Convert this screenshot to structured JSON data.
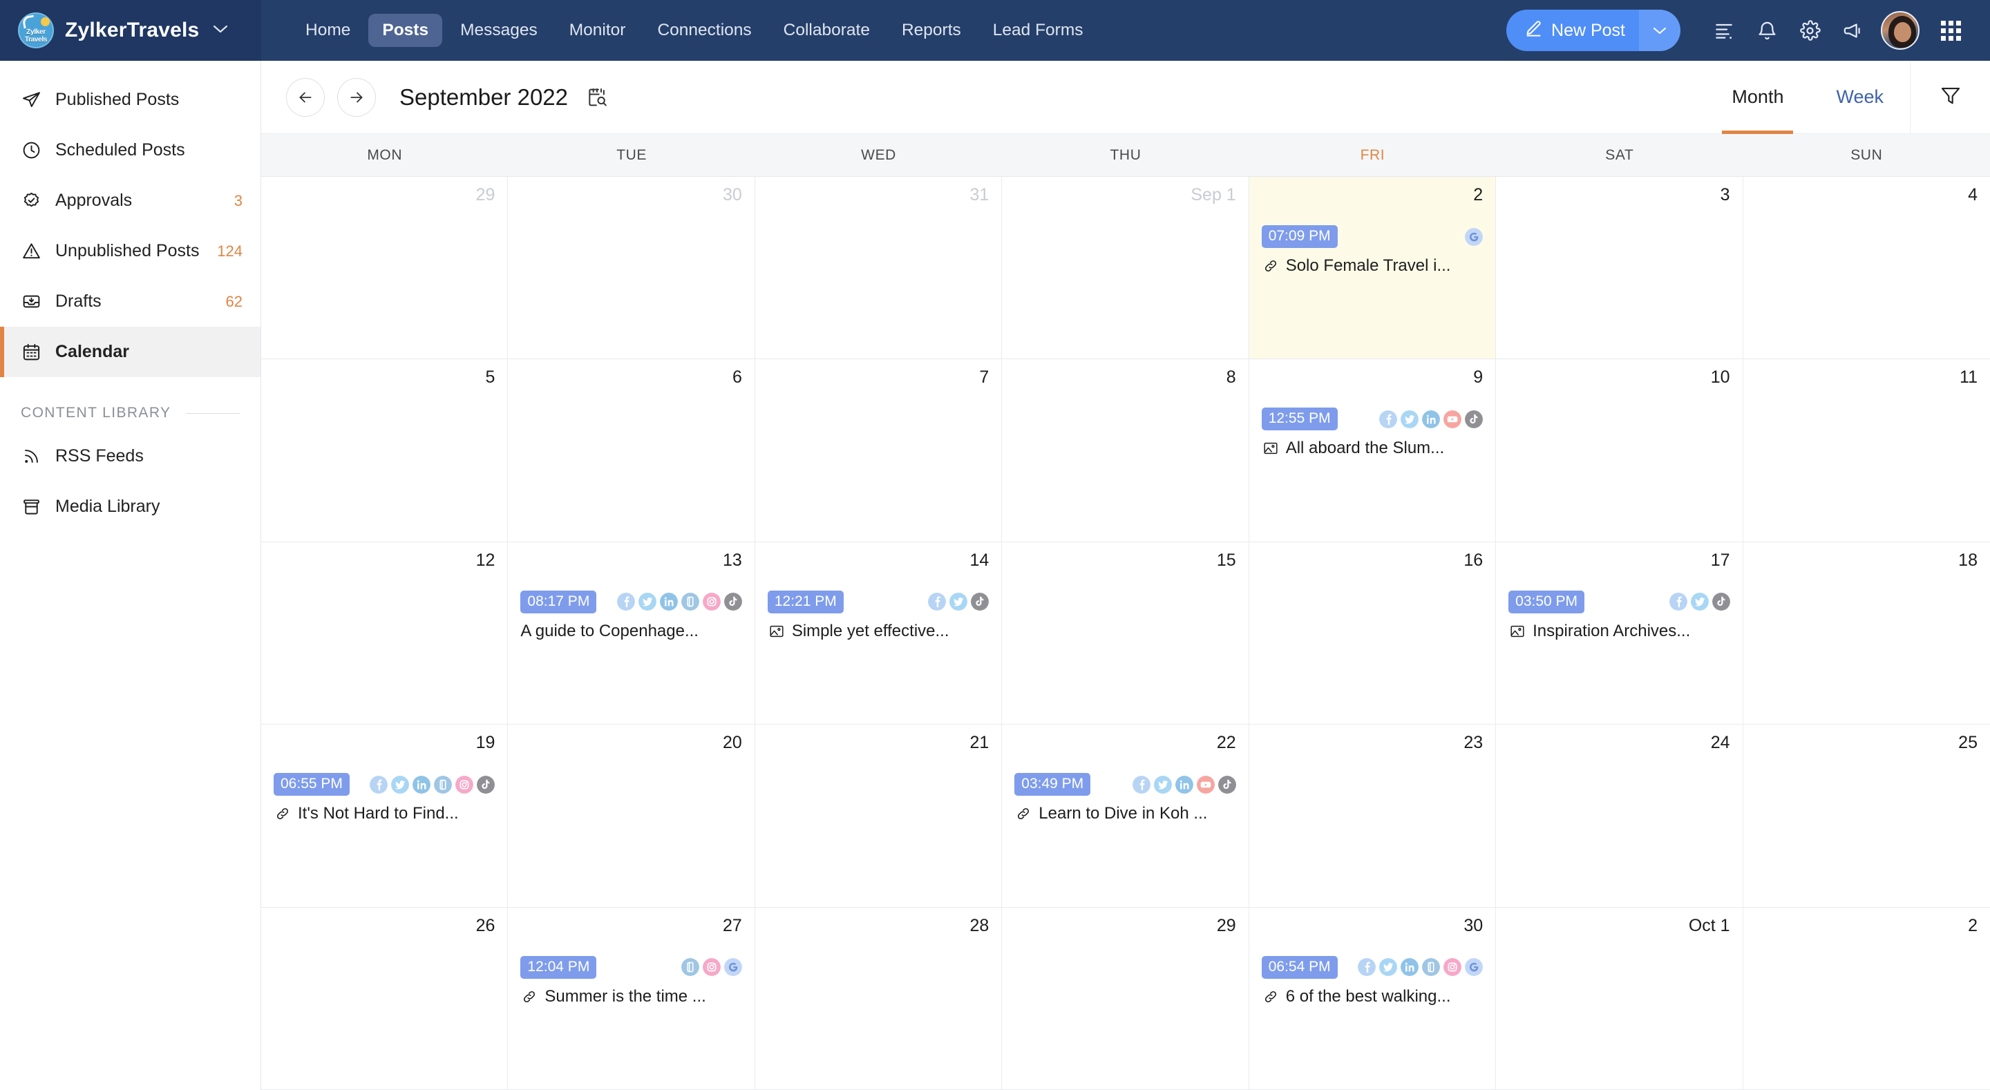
{
  "brand": {
    "name": "ZylkerTravels",
    "logo_line1": "Zylker",
    "logo_line2": "Travels",
    "caret": "⌄"
  },
  "topnav": {
    "items": [
      {
        "label": "Home",
        "active": false
      },
      {
        "label": "Posts",
        "active": true
      },
      {
        "label": "Messages",
        "active": false
      },
      {
        "label": "Monitor",
        "active": false
      },
      {
        "label": "Connections",
        "active": false
      },
      {
        "label": "Collaborate",
        "active": false
      },
      {
        "label": "Reports",
        "active": false
      },
      {
        "label": "Lead Forms",
        "active": false
      }
    ],
    "new_post_label": "New Post",
    "new_post_caret": "⌄",
    "icons": [
      "list-icon",
      "bell-icon",
      "gear-icon",
      "megaphone-icon",
      "avatar",
      "apps-grid-icon"
    ]
  },
  "sidebar": {
    "items": [
      {
        "label": "Published Posts",
        "count": "",
        "icon": "send-icon",
        "active": false
      },
      {
        "label": "Scheduled Posts",
        "count": "",
        "icon": "clock-icon",
        "active": false
      },
      {
        "label": "Approvals",
        "count": "3",
        "icon": "check-badge-icon",
        "active": false
      },
      {
        "label": "Unpublished Posts",
        "count": "124",
        "icon": "warning-icon",
        "active": false
      },
      {
        "label": "Drafts",
        "count": "62",
        "icon": "inbox-icon",
        "active": false
      },
      {
        "label": "Calendar",
        "count": "",
        "icon": "calendar-icon",
        "active": true
      }
    ],
    "library_heading": "CONTENT LIBRARY",
    "library_items": [
      {
        "label": "RSS Feeds",
        "icon": "rss-icon"
      },
      {
        "label": "Media Library",
        "icon": "media-library-icon"
      }
    ]
  },
  "calendar": {
    "title": "September 2022",
    "prev_label": "←",
    "next_label": "→",
    "views": [
      {
        "label": "Month",
        "active": true
      },
      {
        "label": "Week",
        "active": false
      }
    ],
    "weekdays": [
      {
        "label": "MON",
        "today": false
      },
      {
        "label": "TUE",
        "today": false
      },
      {
        "label": "WED",
        "today": false
      },
      {
        "label": "THU",
        "today": false
      },
      {
        "label": "FRI",
        "today": true
      },
      {
        "label": "SAT",
        "today": false
      },
      {
        "label": "SUN",
        "today": false
      }
    ],
    "accent_color": "#e08545",
    "today_cell_color": "#fdfbe7",
    "time_badge_color": "#7e9ceb",
    "weeks": [
      [
        {
          "day": "29",
          "muted": true,
          "today": false,
          "events": []
        },
        {
          "day": "30",
          "muted": true,
          "today": false,
          "events": []
        },
        {
          "day": "31",
          "muted": true,
          "today": false,
          "events": []
        },
        {
          "day": "Sep 1",
          "muted": true,
          "today": false,
          "events": []
        },
        {
          "day": "2",
          "muted": false,
          "today": true,
          "events": [
            {
              "time": "07:09 PM",
              "title": "Solo Female Travel i...",
              "type_icon": "link-icon",
              "socials": [
                "google"
              ]
            }
          ]
        },
        {
          "day": "3",
          "muted": false,
          "today": false,
          "events": []
        },
        {
          "day": "4",
          "muted": false,
          "today": false,
          "events": []
        }
      ],
      [
        {
          "day": "5",
          "muted": false,
          "today": false,
          "events": []
        },
        {
          "day": "6",
          "muted": false,
          "today": false,
          "events": []
        },
        {
          "day": "7",
          "muted": false,
          "today": false,
          "events": []
        },
        {
          "day": "8",
          "muted": false,
          "today": false,
          "events": []
        },
        {
          "day": "9",
          "muted": false,
          "today": false,
          "events": [
            {
              "time": "12:55 PM",
              "title": "All aboard the Slum...",
              "type_icon": "image-icon",
              "socials": [
                "facebook",
                "twitter",
                "linkedin",
                "youtube",
                "tiktok"
              ]
            }
          ]
        },
        {
          "day": "10",
          "muted": false,
          "today": false,
          "events": []
        },
        {
          "day": "11",
          "muted": false,
          "today": false,
          "events": []
        }
      ],
      [
        {
          "day": "12",
          "muted": false,
          "today": false,
          "events": []
        },
        {
          "day": "13",
          "muted": false,
          "today": false,
          "events": [
            {
              "time": "08:17 PM",
              "title": "A guide to Copenhage...",
              "type_icon": "none",
              "socials": [
                "facebook",
                "twitter",
                "linkedin",
                "mastodon",
                "instagram",
                "tiktok"
              ]
            }
          ]
        },
        {
          "day": "14",
          "muted": false,
          "today": false,
          "events": [
            {
              "time": "12:21 PM",
              "title": "Simple yet effective...",
              "type_icon": "image-icon",
              "socials": [
                "facebook",
                "twitter",
                "tiktok"
              ]
            }
          ]
        },
        {
          "day": "15",
          "muted": false,
          "today": false,
          "events": []
        },
        {
          "day": "16",
          "muted": false,
          "today": false,
          "events": []
        },
        {
          "day": "17",
          "muted": false,
          "today": false,
          "events": [
            {
              "time": "03:50 PM",
              "title": "Inspiration Archives...",
              "type_icon": "image-icon",
              "socials": [
                "facebook",
                "twitter",
                "tiktok"
              ]
            }
          ]
        },
        {
          "day": "18",
          "muted": false,
          "today": false,
          "events": []
        }
      ],
      [
        {
          "day": "19",
          "muted": false,
          "today": false,
          "events": [
            {
              "time": "06:55 PM",
              "title": "It's Not Hard to Find...",
              "type_icon": "link-icon",
              "socials": [
                "facebook",
                "twitter",
                "linkedin",
                "mastodon",
                "instagram",
                "tiktok"
              ]
            }
          ]
        },
        {
          "day": "20",
          "muted": false,
          "today": false,
          "events": []
        },
        {
          "day": "21",
          "muted": false,
          "today": false,
          "events": []
        },
        {
          "day": "22",
          "muted": false,
          "today": false,
          "events": [
            {
              "time": "03:49 PM",
              "title": "Learn to Dive in Koh ...",
              "type_icon": "link-icon",
              "socials": [
                "facebook",
                "twitter",
                "linkedin",
                "youtube",
                "tiktok"
              ]
            }
          ]
        },
        {
          "day": "23",
          "muted": false,
          "today": false,
          "events": []
        },
        {
          "day": "24",
          "muted": false,
          "today": false,
          "events": []
        },
        {
          "day": "25",
          "muted": false,
          "today": false,
          "events": []
        }
      ],
      [
        {
          "day": "26",
          "muted": false,
          "today": false,
          "events": []
        },
        {
          "day": "27",
          "muted": false,
          "today": false,
          "events": [
            {
              "time": "12:04 PM",
              "title": "Summer is the time ...",
              "type_icon": "link-icon",
              "socials": [
                "mastodon",
                "instagram",
                "google"
              ]
            }
          ]
        },
        {
          "day": "28",
          "muted": false,
          "today": false,
          "events": []
        },
        {
          "day": "29",
          "muted": false,
          "today": false,
          "events": []
        },
        {
          "day": "30",
          "muted": false,
          "today": false,
          "events": [
            {
              "time": "06:54 PM",
              "title": "6 of the best walking...",
              "type_icon": "link-icon",
              "socials": [
                "facebook",
                "twitter",
                "linkedin",
                "mastodon",
                "instagram",
                "google"
              ]
            }
          ]
        },
        {
          "day": "Oct 1",
          "muted": false,
          "today": false,
          "events": []
        },
        {
          "day": "2",
          "muted": false,
          "today": false,
          "events": []
        }
      ]
    ]
  }
}
